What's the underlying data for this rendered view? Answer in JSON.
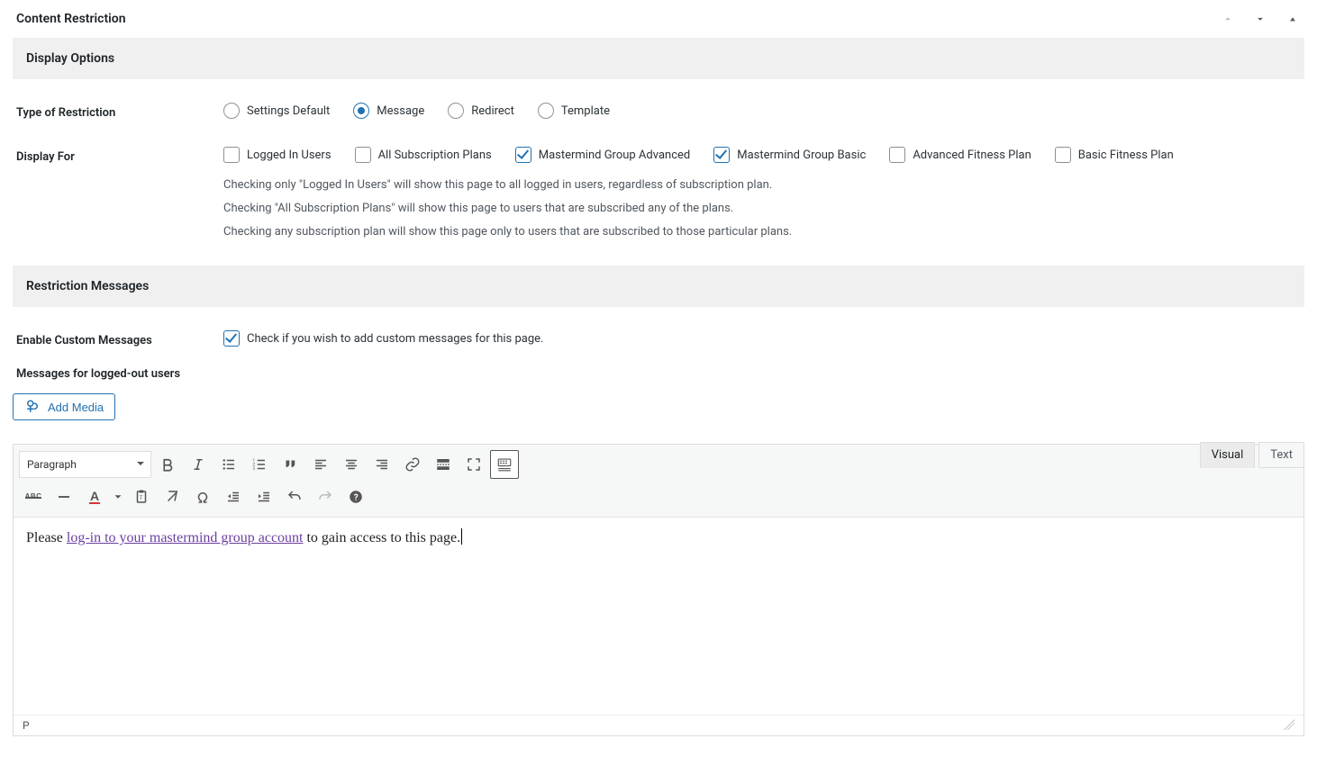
{
  "panel": {
    "title": "Content Restriction"
  },
  "sections": {
    "display_options": "Display Options",
    "restriction_messages": "Restriction Messages"
  },
  "type_of_restriction": {
    "label": "Type of Restriction",
    "options": [
      {
        "label": "Settings Default",
        "checked": false
      },
      {
        "label": "Message",
        "checked": true
      },
      {
        "label": "Redirect",
        "checked": false
      },
      {
        "label": "Template",
        "checked": false
      }
    ]
  },
  "display_for": {
    "label": "Display For",
    "options": [
      {
        "label": "Logged In Users",
        "checked": false
      },
      {
        "label": "All Subscription Plans",
        "checked": false
      },
      {
        "label": "Mastermind Group Advanced",
        "checked": true
      },
      {
        "label": "Mastermind Group Basic",
        "checked": true
      },
      {
        "label": "Advanced Fitness Plan",
        "checked": false
      },
      {
        "label": "Basic Fitness Plan",
        "checked": false
      }
    ],
    "help": [
      "Checking only \"Logged In Users\" will show this page to all logged in users, regardless of subscription plan.",
      "Checking \"All Subscription Plans\" will show this page to users that are subscribed any of the plans.",
      "Checking any subscription plan will show this page only to users that are subscribed to those particular plans."
    ]
  },
  "enable_custom": {
    "label": "Enable Custom Messages",
    "checked": true,
    "text": "Check if you wish to add custom messages for this page."
  },
  "messages_heading": "Messages for logged-out users",
  "add_media_label": "Add Media",
  "editor_tabs": {
    "visual": "Visual",
    "text": "Text"
  },
  "format_select": "Paragraph",
  "editor_content": {
    "before": "Please ",
    "link": "log-in to your mastermind group account",
    "after": " to gain access to this page."
  },
  "status_path": "P"
}
